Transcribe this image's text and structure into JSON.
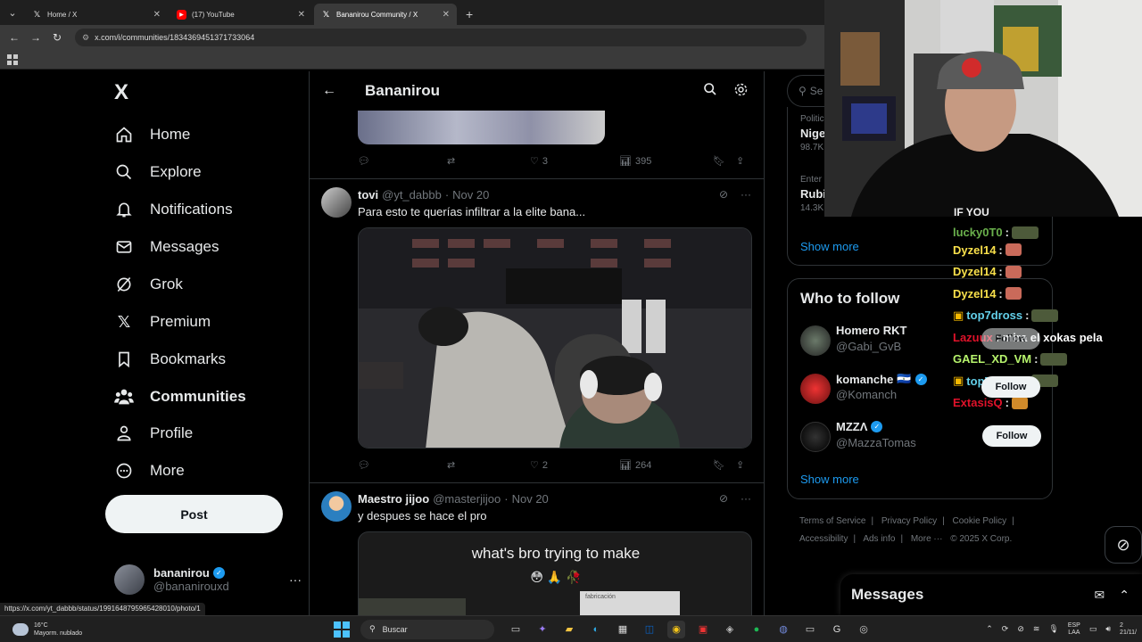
{
  "browser": {
    "tabs": [
      {
        "title": "Home / X",
        "icon": "x-logo-icon",
        "active": false
      },
      {
        "title": "(17) YouTube",
        "icon": "youtube-icon",
        "active": false
      },
      {
        "title": "Bananirou Community / X",
        "icon": "x-logo-icon",
        "active": true
      }
    ],
    "new_tab": "+",
    "url": "x.com/i/communities/1834369451371733064",
    "status_url": "https://x.com/yt_dabbb/status/1991648795965428010/photo/1"
  },
  "left_nav": {
    "logo": "X",
    "items": [
      {
        "label": "Home",
        "icon": "home-icon"
      },
      {
        "label": "Explore",
        "icon": "search-icon"
      },
      {
        "label": "Notifications",
        "icon": "bell-icon"
      },
      {
        "label": "Messages",
        "icon": "envelope-icon"
      },
      {
        "label": "Grok",
        "icon": "grok-icon"
      },
      {
        "label": "Premium",
        "icon": "x-logo-icon"
      },
      {
        "label": "Bookmarks",
        "icon": "bookmark-icon"
      },
      {
        "label": "Communities",
        "icon": "people-icon"
      },
      {
        "label": "Profile",
        "icon": "person-icon"
      },
      {
        "label": "More",
        "icon": "more-circle-icon"
      }
    ],
    "post_label": "Post",
    "account": {
      "name": "bananirou",
      "handle": "@bananirouxd",
      "more": "···"
    }
  },
  "feed": {
    "title": "Bananirou",
    "prev_post": {
      "replies": "",
      "reposts": "",
      "likes": "3",
      "views": "395"
    },
    "posts": [
      {
        "name": "tovi",
        "handle": "@yt_dabbb",
        "date": "Nov 20",
        "text": "Para esto te querías infiltrar a la elite bana...",
        "likes": "2",
        "views": "264"
      },
      {
        "name": "Maestro jijoo",
        "handle": "@masterjijoo",
        "date": "Nov 20",
        "text": "y despues se hace el pro",
        "media_caption": "what's bro trying to make",
        "media_emojis": "😳 🙏 🥀",
        "media_sign": "fabricación"
      }
    ]
  },
  "right_col": {
    "search_placeholder": "Se",
    "trends": [
      {
        "category": "Politic",
        "title": "Nige",
        "count": "98.7K"
      },
      {
        "category": "Enter",
        "title": "Rubi",
        "count": "14.3K"
      }
    ],
    "show_more": "Show more",
    "who_to_follow": {
      "title": "Who to follow",
      "follow_label": "Follow",
      "accounts": [
        {
          "name": "Homero RKT",
          "handle": "@Gabi_GvB",
          "verified": false,
          "flag": ""
        },
        {
          "name": "komanche",
          "handle": "@Komanch",
          "verified": true,
          "flag": "🇸🇻"
        },
        {
          "name": "MZZΛ",
          "handle": "@MazzaTomas",
          "verified": true,
          "flag": ""
        }
      ],
      "show_more": "Show more"
    },
    "footer": [
      "Terms of Service",
      "|",
      "Privacy Policy",
      "|",
      "Cookie Policy",
      "|",
      "Accessibility",
      "|",
      "Ads info",
      "|",
      "More ···",
      "© 2025 X Corp."
    ],
    "messages_title": "Messages"
  },
  "chat": [
    {
      "user": "lucky0T0",
      "msg": ":",
      "color": "#6ab04c"
    },
    {
      "user": "Dyzel14",
      "msg": ":",
      "color": "#f9e04b"
    },
    {
      "user": "Dyzel14",
      "msg": ":",
      "color": "#f9e04b"
    },
    {
      "user": "Dyzel14",
      "msg": ":",
      "color": "#f9e04b"
    },
    {
      "user": "top7dross",
      "msg": ":",
      "color": "#63d0ea",
      "badge": true
    },
    {
      "user": "Lazuux",
      "msg": ": mira el xokas pela",
      "color": "#e0122a"
    },
    {
      "user": "GAEL_XD_VM",
      "msg": ":",
      "color": "#b6f36c"
    },
    {
      "user": "top7dross",
      "msg": ":",
      "color": "#63d0ea",
      "badge": true
    },
    {
      "user": "ExtasisQ",
      "msg": ":",
      "color": "#e0122a"
    }
  ],
  "taskbar": {
    "temp": "16°C",
    "weather": "Mayorm. nublado",
    "search": "Buscar",
    "lang_top": "ESP",
    "lang_bottom": "LAA",
    "time": "2",
    "date": "21/11/"
  }
}
